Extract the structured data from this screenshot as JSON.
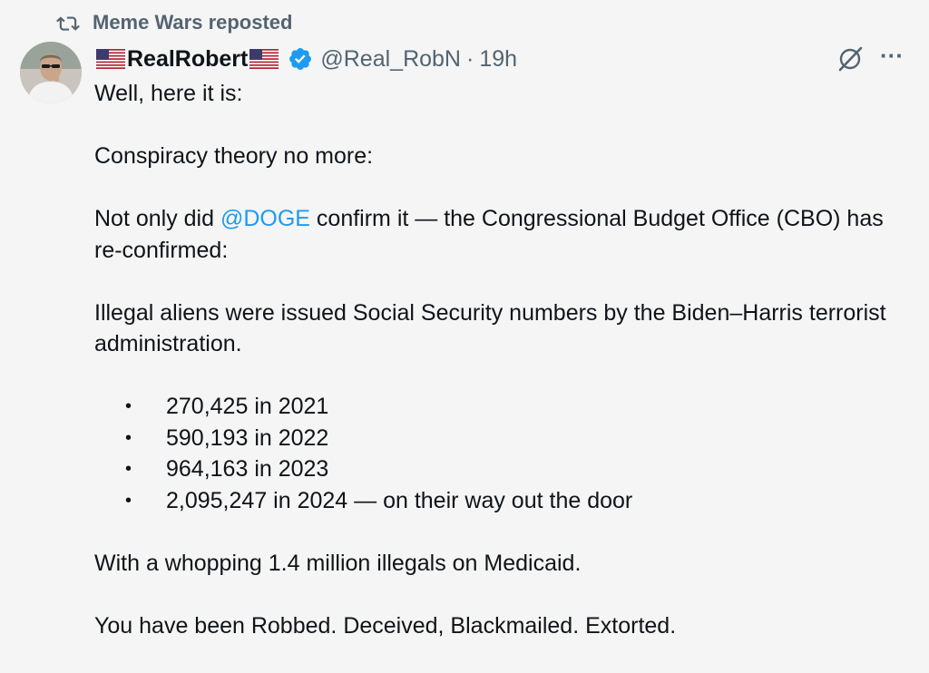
{
  "repost": {
    "label": "Meme Wars reposted",
    "icon": "repost-icon"
  },
  "author": {
    "display_name": "RealRobert",
    "handle": "@Real_RobN",
    "separator": "·",
    "time": "19h",
    "verified_color": "#1d9bf0"
  },
  "tweet": {
    "p1": "Well, here it is:",
    "p2": "Conspiracy theory no more:",
    "p3_pre": "Not only did ",
    "p3_mention": "@DOGE",
    "p3_post": " confirm it — the Congressional Budget Office (CBO) has re-confirmed:",
    "p4": "Illegal aliens were issued Social Security numbers by the Biden–Harris terrorist administration.",
    "bullets": [
      "270,425 in 2021",
      "590,193 in 2022",
      "964,163 in 2023",
      "2,095,247 in 2024 — on their way out the door"
    ],
    "bullet_char": "•",
    "p5": "With a whopping 1.4 million illegals on Medicaid.",
    "p6": "You have been Robbed. Deceived, Blackmailed. Extorted."
  },
  "actions": {
    "grok_icon": "grok-icon",
    "more_label": "···"
  },
  "colors": {
    "accent": "#1d9bf0",
    "muted": "#536471",
    "text": "#0f1419",
    "background": "#f5f5f5"
  }
}
